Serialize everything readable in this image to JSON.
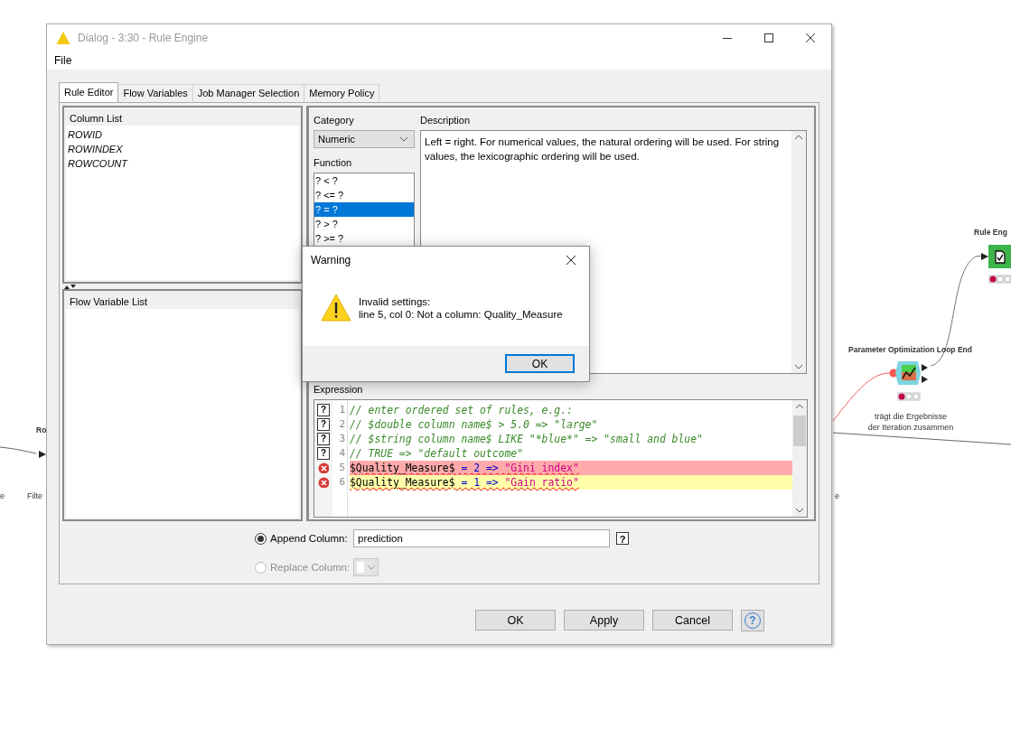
{
  "workflow": {
    "texts": [
      {
        "kind": "title",
        "text": "Ro"
      },
      {
        "kind": "caption",
        "text": "e"
      },
      {
        "kind": "caption",
        "text": "Filte"
      },
      {
        "kind": "title",
        "text": "Rule Eng"
      },
      {
        "kind": "title",
        "text": "Parameter Optimization Loop End"
      },
      {
        "kind": "caption",
        "lines": [
          "trägt die Ergebnisse",
          "der Iteration zusammen"
        ]
      },
      {
        "kind": "caption",
        "text": "e"
      }
    ]
  },
  "window": {
    "title": "Dialog - 3:30 - Rule Engine",
    "menu": [
      "File"
    ]
  },
  "tabs": [
    {
      "label": "Rule Editor",
      "selected": true
    },
    {
      "label": "Flow Variables",
      "selected": false
    },
    {
      "label": "Job Manager Selection",
      "selected": false
    },
    {
      "label": "Memory Policy",
      "selected": false
    }
  ],
  "column_list": {
    "title": "Column List",
    "items": [
      "ROWID",
      "ROWINDEX",
      "ROWCOUNT"
    ]
  },
  "flow_variable_list": {
    "title": "Flow Variable List"
  },
  "category": {
    "label": "Category",
    "value": "Numeric"
  },
  "function": {
    "label": "Function",
    "items": [
      {
        "text": "? < ?",
        "selected": false
      },
      {
        "text": "? <= ?",
        "selected": false
      },
      {
        "text": "? = ?",
        "selected": true
      },
      {
        "text": "? > ?",
        "selected": false
      },
      {
        "text": "? >= ?",
        "selected": false
      }
    ]
  },
  "description": {
    "label": "Description",
    "text": "Left = right. For numerical values, the natural ordering will be used. For string values, the lexicographic ordering will be used."
  },
  "expression": {
    "label": "Expression",
    "lines": [
      {
        "number": "1",
        "marker": {
          "kind": "help",
          "symbol": "?"
        },
        "error_highlight": false,
        "current": false,
        "parts": [
          {
            "kind": "comment",
            "text": "// enter ordered set of rules, e.g.:"
          }
        ]
      },
      {
        "number": "2",
        "marker": {
          "kind": "help",
          "symbol": "?"
        },
        "error_highlight": false,
        "current": false,
        "parts": [
          {
            "kind": "comment",
            "text": "// $double column name$ > 5.0 => \"large\""
          }
        ]
      },
      {
        "number": "3",
        "marker": {
          "kind": "help",
          "symbol": "?"
        },
        "error_highlight": false,
        "current": false,
        "parts": [
          {
            "kind": "comment",
            "text": "// $string column name$ LIKE \"*blue*\" => \"small and blue\""
          }
        ]
      },
      {
        "number": "4",
        "marker": {
          "kind": "help",
          "symbol": "?"
        },
        "error_highlight": false,
        "current": false,
        "parts": [
          {
            "kind": "comment",
            "text": "// TRUE => \"default outcome\""
          }
        ]
      },
      {
        "number": "5",
        "marker": {
          "kind": "error"
        },
        "error_highlight": true,
        "current": false,
        "parts": [
          {
            "kind": "column",
            "text": "$Quality_Measure$"
          },
          {
            "kind": "operator",
            "text": "= 2 =>"
          },
          {
            "kind": "string",
            "text": "\"Gini index\""
          }
        ]
      },
      {
        "number": "6",
        "marker": {
          "kind": "error"
        },
        "error_highlight": false,
        "current": true,
        "parts": [
          {
            "kind": "column",
            "text": "$Quality_Measure$"
          },
          {
            "kind": "operator",
            "text": "= 1 =>"
          },
          {
            "kind": "string",
            "text": "\"Gain ratio\""
          }
        ]
      }
    ]
  },
  "output": {
    "append": {
      "label": "Append Column:",
      "selected": true,
      "value": "prediction",
      "help": "?"
    },
    "replace": {
      "label": "Replace Column:",
      "selected": false,
      "disabled": true
    }
  },
  "buttons": [
    {
      "kind": "text",
      "label": "OK"
    },
    {
      "kind": "text",
      "label": "Apply"
    },
    {
      "kind": "text",
      "label": "Cancel"
    },
    {
      "kind": "help",
      "label": "?"
    }
  ],
  "warning": {
    "title": "Warning",
    "lines": [
      "Invalid settings:",
      "line 5, col 0: Not a column: Quality_Measure"
    ],
    "button": "OK"
  }
}
